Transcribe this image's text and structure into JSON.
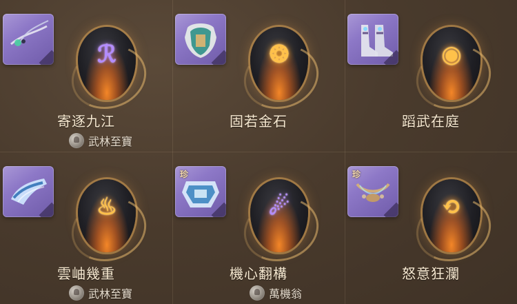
{
  "cells": [
    {
      "name": "寄逐九江",
      "source": "武林至寶",
      "tag": ""
    },
    {
      "name": "固若金石",
      "source": "",
      "tag": ""
    },
    {
      "name": "蹈武在庭",
      "source": "",
      "tag": ""
    },
    {
      "name": "雲岫幾重",
      "source": "武林至寶",
      "tag": ""
    },
    {
      "name": "機心翻構",
      "source": "萬機翁",
      "tag": "珍"
    },
    {
      "name": "怒意狂瀾",
      "source": "",
      "tag": "珍"
    }
  ],
  "icons": [
    {
      "item": "insect-ornament-icon",
      "stone_glyph": "purple-rune-icon"
    },
    {
      "item": "armor-icon",
      "stone_glyph": "gold-cloud-rune-icon"
    },
    {
      "item": "boots-icon",
      "stone_glyph": "gold-swirl-rune-icon"
    },
    {
      "item": "gauntlet-icon",
      "stone_glyph": "gold-flame-rune-icon"
    },
    {
      "item": "mechanism-icon",
      "stone_glyph": "purple-wing-rune-icon"
    },
    {
      "item": "necklace-icon",
      "stone_glyph": "gold-spiral-rune-icon"
    }
  ],
  "colors": {
    "background": "#4a3b2d",
    "card_purple": "#8d78c7",
    "rune_gold": "#ffc14a",
    "rune_purple": "#b38cff",
    "text": "#f6e8d0"
  }
}
